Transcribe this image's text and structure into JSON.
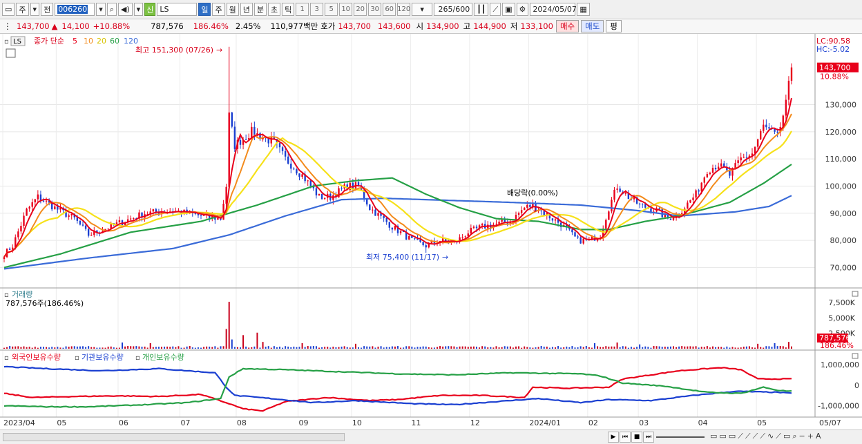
{
  "toolbar": {
    "period_buttons": [
      "주",
      "전"
    ],
    "code": "006260",
    "shin_label": "신",
    "name": "LS",
    "tf_buttons": [
      "일",
      "주",
      "월",
      "년",
      "분",
      "초",
      "틱"
    ],
    "selected_tf": "일",
    "num_buttons": [
      "1",
      "3",
      "5",
      "10",
      "20",
      "30",
      "60",
      "120"
    ],
    "count": "265",
    "count_total": "/600",
    "date": "2024/05/07"
  },
  "quote": {
    "price": "143,700",
    "change_arrow": "▲",
    "change": "14,100",
    "change_pct": "+10.88%",
    "volume": "787,576",
    "volume_pct": "186.46%",
    "turnover": "2.45%",
    "amount": "110,977백만",
    "hoga_label": "호가",
    "ask": "143,700",
    "bid": "143,600",
    "open_label": "시",
    "open": "134,900",
    "high_label": "고",
    "high": "144,900",
    "low_label": "저",
    "low": "133,100",
    "sell_button": "매수",
    "buy_button": "매도",
    "avg_button": "평"
  },
  "chart_data": [
    {
      "type": "candlestick",
      "title": "LS",
      "legend": {
        "label": "종가 단순",
        "periods": [
          "5",
          "10",
          "20",
          "60",
          "120"
        ]
      },
      "colors": {
        "up": "#e8001b",
        "down": "#1a3fd1",
        "ma5": "#e8001b",
        "ma10": "#f38b1c",
        "ma20": "#f6e11a",
        "ma60": "#26a046",
        "ma120": "#3a6bd8"
      },
      "x_labels": [
        "2023/04",
        "05",
        "06",
        "07",
        "08",
        "09",
        "10",
        "11",
        "12",
        "2024/01",
        "02",
        "03",
        "04",
        "05",
        "05/07"
      ],
      "y_ticks": [
        "70,000",
        "80,000",
        "90,000",
        "100,000",
        "110,000",
        "120,000",
        "130,000"
      ],
      "ylim": [
        64000,
        151500
      ],
      "lc": "LC:90.58",
      "hc": "HC:-5.02",
      "current_label": "143,700",
      "current_pct": "10.88%",
      "current_value": 143700,
      "annotations": {
        "high": "최고 151,300 (07/26)",
        "low": "최저 75,400 (11/17)",
        "dividend": "배당락(0.00%)"
      },
      "close_anchors": [
        [
          0,
          75000
        ],
        [
          3,
          78000
        ],
        [
          8,
          91000
        ],
        [
          12,
          96000
        ],
        [
          18,
          92000
        ],
        [
          25,
          88000
        ],
        [
          30,
          82000
        ],
        [
          40,
          86000
        ],
        [
          50,
          90000
        ],
        [
          60,
          91000
        ],
        [
          70,
          89000
        ],
        [
          77,
          88000
        ],
        [
          79,
          100000
        ],
        [
          80,
          126000
        ],
        [
          82,
          115000
        ],
        [
          88,
          120000
        ],
        [
          92,
          118000
        ],
        [
          96,
          116000
        ],
        [
          100,
          110000
        ],
        [
          106,
          104000
        ],
        [
          112,
          96000
        ],
        [
          116,
          96000
        ],
        [
          122,
          100000
        ],
        [
          126,
          100000
        ],
        [
          130,
          92000
        ],
        [
          138,
          85000
        ],
        [
          145,
          80000
        ],
        [
          150,
          78000
        ],
        [
          155,
          80000
        ],
        [
          160,
          79000
        ],
        [
          165,
          83000
        ],
        [
          170,
          85000
        ],
        [
          175,
          86000
        ],
        [
          180,
          87000
        ],
        [
          185,
          92000
        ],
        [
          188,
          93000
        ],
        [
          192,
          90000
        ],
        [
          198,
          86000
        ],
        [
          204,
          80000
        ],
        [
          208,
          80000
        ],
        [
          212,
          82000
        ],
        [
          215,
          92000
        ],
        [
          218,
          100000
        ],
        [
          222,
          96000
        ],
        [
          226,
          93000
        ],
        [
          232,
          91000
        ],
        [
          236,
          88000
        ],
        [
          240,
          90000
        ],
        [
          246,
          97000
        ],
        [
          250,
          106000
        ],
        [
          254,
          108000
        ],
        [
          258,
          104000
        ],
        [
          262,
          110000
        ],
        [
          266,
          112000
        ],
        [
          270,
          122000
        ],
        [
          275,
          118000
        ],
        [
          278,
          130000
        ],
        [
          280,
          143700
        ]
      ],
      "ma60_anchors": [
        [
          0,
          70000
        ],
        [
          20,
          75000
        ],
        [
          45,
          83000
        ],
        [
          70,
          87000
        ],
        [
          90,
          93000
        ],
        [
          110,
          100000
        ],
        [
          125,
          102000
        ],
        [
          138,
          103000
        ],
        [
          150,
          97000
        ],
        [
          162,
          92000
        ],
        [
          175,
          88000
        ],
        [
          190,
          87000
        ],
        [
          205,
          84000
        ],
        [
          215,
          84000
        ],
        [
          228,
          87000
        ],
        [
          240,
          89000
        ],
        [
          258,
          94000
        ],
        [
          270,
          101000
        ],
        [
          280,
          108000
        ]
      ],
      "ma120_anchors": [
        [
          0,
          69500
        ],
        [
          30,
          73500
        ],
        [
          60,
          77000
        ],
        [
          80,
          82000
        ],
        [
          100,
          89000
        ],
        [
          120,
          95000
        ],
        [
          135,
          95500
        ],
        [
          150,
          95000
        ],
        [
          180,
          94000
        ],
        [
          205,
          93000
        ],
        [
          225,
          91000
        ],
        [
          240,
          89000
        ],
        [
          260,
          90500
        ],
        [
          272,
          92500
        ],
        [
          280,
          96500
        ]
      ]
    },
    {
      "type": "bar",
      "title": "거래량",
      "readout": "787,576주(186.46%)",
      "y_ticks": [
        "2,500K",
        "5,000K",
        "7,500K"
      ],
      "current_label": "787,576",
      "current_pct": "186.46%",
      "ylim": [
        0,
        8500
      ],
      "spikes": [
        [
          42,
          1000
        ],
        [
          52,
          900
        ],
        [
          79,
          3200
        ],
        [
          80,
          7600
        ],
        [
          81,
          1500
        ],
        [
          85,
          2200
        ],
        [
          90,
          2600
        ],
        [
          92,
          1100
        ],
        [
          106,
          900
        ],
        [
          125,
          800
        ],
        [
          210,
          900
        ],
        [
          218,
          1000
        ],
        [
          226,
          700
        ],
        [
          268,
          800
        ],
        [
          274,
          900
        ],
        [
          279,
          1100
        ]
      ],
      "base": 300,
      "base_color_even": "#c9001b",
      "base_color_odd": "#1a3fd1"
    },
    {
      "type": "line",
      "series": [
        {
          "name": "외국인보유수량",
          "color": "#e8001b",
          "anchors": [
            [
              0,
              -400000
            ],
            [
              10,
              -600000
            ],
            [
              25,
              -550000
            ],
            [
              40,
              -520000
            ],
            [
              55,
              -550000
            ],
            [
              70,
              -450000
            ],
            [
              80,
              -900000
            ],
            [
              85,
              -1150000
            ],
            [
              92,
              -1250000
            ],
            [
              100,
              -800000
            ],
            [
              115,
              -600000
            ],
            [
              130,
              -750000
            ],
            [
              140,
              -700000
            ],
            [
              155,
              -500000
            ],
            [
              170,
              -500000
            ],
            [
              185,
              -600000
            ],
            [
              188,
              -100000
            ],
            [
              200,
              -150000
            ],
            [
              215,
              -100000
            ],
            [
              220,
              300000
            ],
            [
              240,
              700000
            ],
            [
              255,
              850000
            ],
            [
              262,
              750000
            ],
            [
              268,
              300000
            ],
            [
              274,
              300000
            ],
            [
              280,
              300000
            ]
          ]
        },
        {
          "name": "기관보유수량",
          "color": "#1a3fd1",
          "anchors": [
            [
              0,
              900000
            ],
            [
              15,
              800000
            ],
            [
              35,
              700000
            ],
            [
              55,
              800000
            ],
            [
              75,
              600000
            ],
            [
              79,
              -100000
            ],
            [
              82,
              -500000
            ],
            [
              95,
              -650000
            ],
            [
              110,
              -850000
            ],
            [
              125,
              -750000
            ],
            [
              145,
              -900000
            ],
            [
              160,
              -950000
            ],
            [
              175,
              -800000
            ],
            [
              190,
              -650000
            ],
            [
              205,
              -850000
            ],
            [
              215,
              -700000
            ],
            [
              230,
              -750000
            ],
            [
              245,
              -500000
            ],
            [
              260,
              -300000
            ],
            [
              275,
              -350000
            ],
            [
              280,
              -400000
            ]
          ]
        },
        {
          "name": "개인보유수량",
          "color": "#26a046",
          "anchors": [
            [
              0,
              -1000000
            ],
            [
              15,
              -1050000
            ],
            [
              30,
              -1050000
            ],
            [
              50,
              -950000
            ],
            [
              65,
              -850000
            ],
            [
              77,
              -650000
            ],
            [
              80,
              400000
            ],
            [
              85,
              800000
            ],
            [
              100,
              750000
            ],
            [
              120,
              650000
            ],
            [
              140,
              550000
            ],
            [
              160,
              500000
            ],
            [
              180,
              600000
            ],
            [
              205,
              550000
            ],
            [
              212,
              450000
            ],
            [
              220,
              100000
            ],
            [
              235,
              -50000
            ],
            [
              250,
              -350000
            ],
            [
              262,
              -400000
            ],
            [
              270,
              -100000
            ],
            [
              275,
              -250000
            ],
            [
              280,
              -300000
            ]
          ]
        }
      ],
      "y_ticks": [
        "1,000,000",
        "0",
        "-1,000,000"
      ],
      "ylim": [
        -1450000,
        1300000
      ]
    }
  ]
}
